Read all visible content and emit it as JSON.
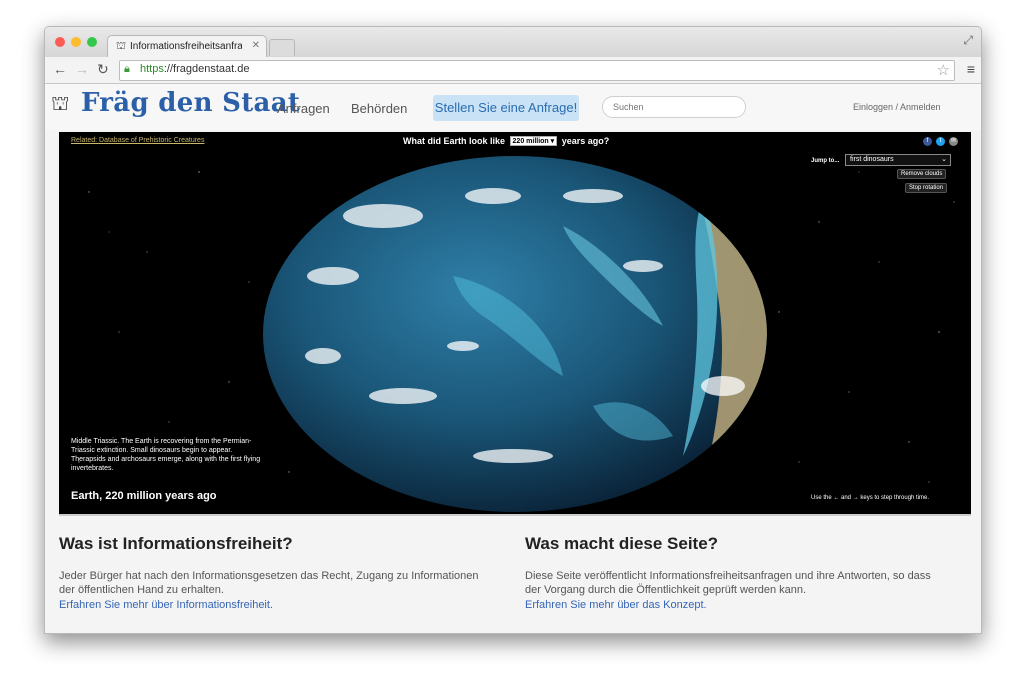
{
  "browser": {
    "tab_title": "Informationsfreiheitsanfrag",
    "url_scheme": "https",
    "url_rest": "://fragdenstaat.de"
  },
  "site": {
    "logo_text": "Fräg den Staat",
    "nav": [
      "Anfragen",
      "Behörden"
    ],
    "cta_label": "Stellen Sie eine Anfrage!",
    "search_placeholder": "Suchen",
    "login_label": "Einloggen / Anmelden"
  },
  "embed": {
    "link_text": "Related: Database of Prehistoric Creatures",
    "title_before": "What did Earth look like",
    "era_value": "220 million",
    "title_after": "years ago?",
    "jump_label": "Jump to...",
    "jump_value": "first dinosaurs",
    "remove_clouds": "Remove clouds",
    "stop_rotation": "Stop rotation",
    "description": "Middle Triassic. The Earth is recovering from the Permian-Triassic extinction. Small dinosaurs begin to appear. Therapsids and archosaurs emerge, along with the first flying invertebrates.",
    "caption": "Earth, 220 million years ago",
    "hint": "Use the ← and → keys to step through time."
  },
  "sections": [
    {
      "title": "Was ist Informationsfreiheit?",
      "text": "Jeder Bürger hat nach den Informationsgesetzen das Recht, Zugang zu Informationen der öffentlichen Hand zu erhalten.",
      "link": "Erfahren Sie mehr über Informationsfreiheit."
    },
    {
      "title": "Was macht diese Seite?",
      "text": "Diese Seite veröffentlicht Informationsfreiheitsanfragen und ihre Antworten, so dass der Vorgang durch die Öffentlichkeit geprüft werden kann.",
      "link": "Erfahren Sie mehr über das Konzept."
    }
  ],
  "colors": {
    "brand_blue": "#2b5fa8",
    "cta_bg": "#c9e2f6",
    "link_blue": "#3565b5"
  }
}
